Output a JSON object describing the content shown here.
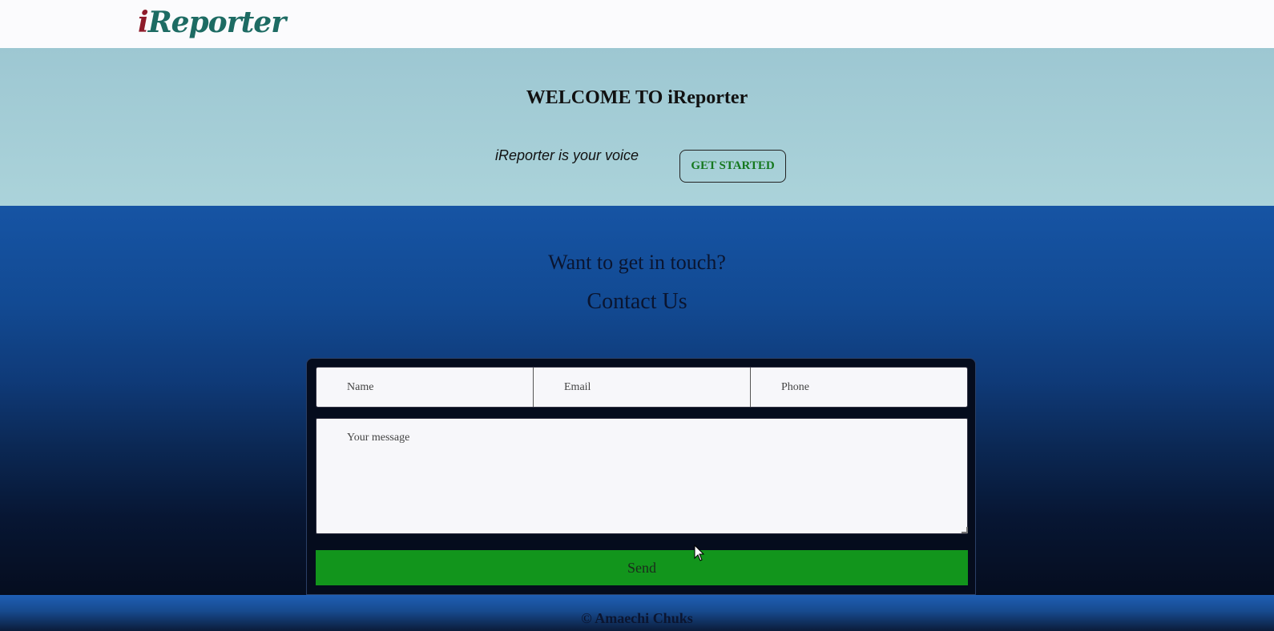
{
  "header": {
    "logo_first": "i",
    "logo_rest": "Reporter"
  },
  "hero": {
    "title": "WELCOME TO iReporter",
    "tagline": "iReporter is your voice",
    "cta_label": "GET STARTED"
  },
  "contact": {
    "pre_title": "Want to get in touch?",
    "title": "Contact Us",
    "form": {
      "name_placeholder": "Name",
      "email_placeholder": "Email",
      "phone_placeholder": "Phone",
      "message_placeholder": "Your message",
      "send_label": "Send"
    }
  },
  "footer": {
    "text": "© Amaechi Chuks"
  },
  "colors": {
    "logo_i": "#8e1b2a",
    "logo_rest": "#1d6b63",
    "cta_text": "#15781e",
    "send_button": "#12951c"
  }
}
